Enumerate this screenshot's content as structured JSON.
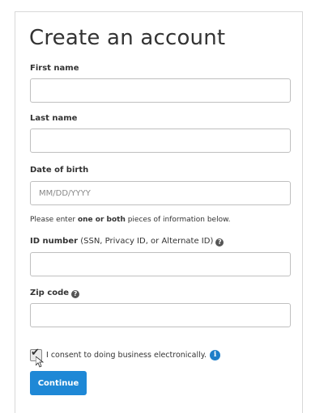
{
  "form": {
    "title": "Create an account",
    "first_name": {
      "label": "First name",
      "value": "",
      "placeholder": ""
    },
    "last_name": {
      "label": "Last name",
      "value": "",
      "placeholder": ""
    },
    "dob": {
      "label": "Date of birth",
      "value": "",
      "placeholder": "MM/DD/YYYY"
    },
    "note": {
      "prefix": "Please enter ",
      "emphasis": "one or both",
      "suffix": " pieces of information below."
    },
    "id_number": {
      "label": "ID number",
      "hint": " (SSN, Privacy ID, or Alternate ID)",
      "value": "",
      "help_icon": "help-icon"
    },
    "zip": {
      "label": "Zip code",
      "value": "",
      "help_icon": "help-icon"
    },
    "consent": {
      "label": "I consent to doing business electronically.",
      "checked": true,
      "info_icon": "info-icon"
    },
    "continue_label": "Continue"
  },
  "colors": {
    "button": "#1e88d6",
    "info_blue": "#1e7ec8",
    "border": "#bfbfbf"
  }
}
